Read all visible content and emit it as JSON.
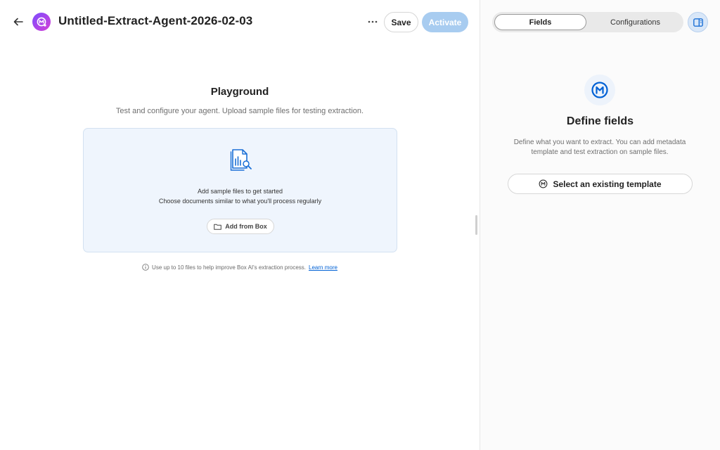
{
  "header": {
    "title": "Untitled-Extract-Agent-2026-02-03",
    "save_label": "Save",
    "activate_label": "Activate",
    "icons": {
      "back": "arrow-left-icon",
      "avatar": "extract-agent-icon",
      "more": "more-horizontal-icon"
    }
  },
  "playground": {
    "title": "Playground",
    "subtitle": "Test and configure your agent. Upload sample files for testing extraction.",
    "dropzone": {
      "line1": "Add sample files to get started",
      "line2": "Choose documents similar to what you'll process regularly",
      "add_button_label": "Add from Box",
      "icons": {
        "document": "document-search-icon",
        "folder": "folder-icon"
      }
    },
    "footnote": {
      "text": "Use up to 10 files to help improve Box AI's extraction process.",
      "link": "Learn more",
      "icon": "info-icon"
    }
  },
  "side_panel": {
    "tabs": [
      {
        "label": "Fields",
        "active": true
      },
      {
        "label": "Configurations",
        "active": false
      }
    ],
    "toggle_icon": "panel-toggle-icon",
    "empty_state": {
      "icon": "metadata-icon",
      "title": "Define fields",
      "description": "Define what you want to extract. You can add metadata template and test extraction on sample files.",
      "button_label": "Select an existing template",
      "button_icon": "metadata-icon"
    }
  },
  "colors": {
    "accent": "#0061d5",
    "activate_disabled": "#a8ccf0",
    "dropzone_bg": "#eff5fd"
  }
}
